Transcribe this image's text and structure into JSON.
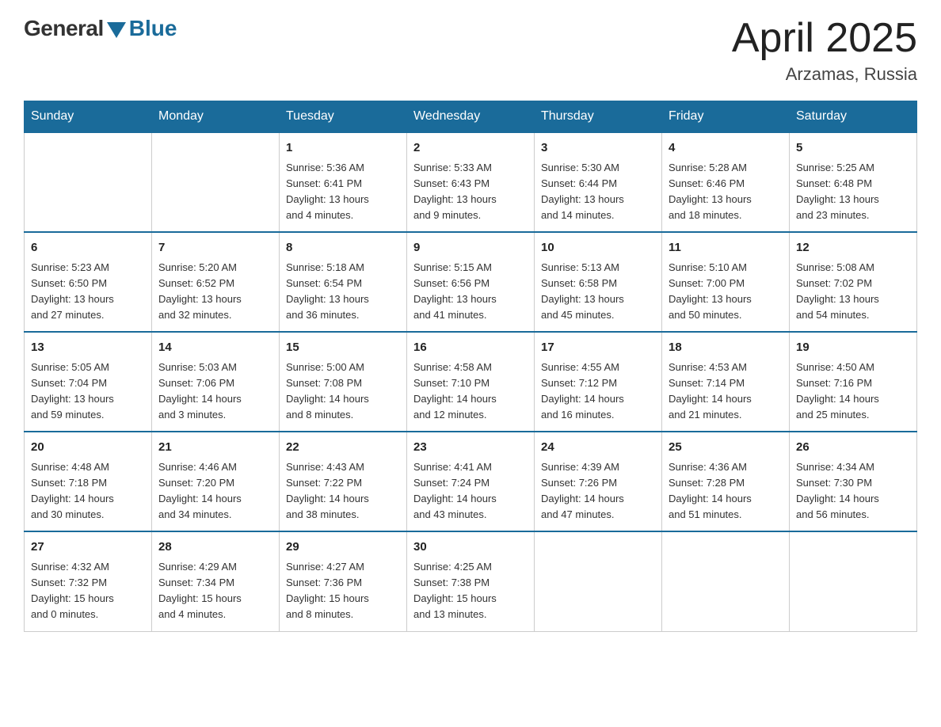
{
  "header": {
    "logo_general": "General",
    "logo_blue": "Blue",
    "title": "April 2025",
    "location": "Arzamas, Russia"
  },
  "days_of_week": [
    "Sunday",
    "Monday",
    "Tuesday",
    "Wednesday",
    "Thursday",
    "Friday",
    "Saturday"
  ],
  "weeks": [
    [
      {
        "day": "",
        "info": ""
      },
      {
        "day": "",
        "info": ""
      },
      {
        "day": "1",
        "info": "Sunrise: 5:36 AM\nSunset: 6:41 PM\nDaylight: 13 hours\nand 4 minutes."
      },
      {
        "day": "2",
        "info": "Sunrise: 5:33 AM\nSunset: 6:43 PM\nDaylight: 13 hours\nand 9 minutes."
      },
      {
        "day": "3",
        "info": "Sunrise: 5:30 AM\nSunset: 6:44 PM\nDaylight: 13 hours\nand 14 minutes."
      },
      {
        "day": "4",
        "info": "Sunrise: 5:28 AM\nSunset: 6:46 PM\nDaylight: 13 hours\nand 18 minutes."
      },
      {
        "day": "5",
        "info": "Sunrise: 5:25 AM\nSunset: 6:48 PM\nDaylight: 13 hours\nand 23 minutes."
      }
    ],
    [
      {
        "day": "6",
        "info": "Sunrise: 5:23 AM\nSunset: 6:50 PM\nDaylight: 13 hours\nand 27 minutes."
      },
      {
        "day": "7",
        "info": "Sunrise: 5:20 AM\nSunset: 6:52 PM\nDaylight: 13 hours\nand 32 minutes."
      },
      {
        "day": "8",
        "info": "Sunrise: 5:18 AM\nSunset: 6:54 PM\nDaylight: 13 hours\nand 36 minutes."
      },
      {
        "day": "9",
        "info": "Sunrise: 5:15 AM\nSunset: 6:56 PM\nDaylight: 13 hours\nand 41 minutes."
      },
      {
        "day": "10",
        "info": "Sunrise: 5:13 AM\nSunset: 6:58 PM\nDaylight: 13 hours\nand 45 minutes."
      },
      {
        "day": "11",
        "info": "Sunrise: 5:10 AM\nSunset: 7:00 PM\nDaylight: 13 hours\nand 50 minutes."
      },
      {
        "day": "12",
        "info": "Sunrise: 5:08 AM\nSunset: 7:02 PM\nDaylight: 13 hours\nand 54 minutes."
      }
    ],
    [
      {
        "day": "13",
        "info": "Sunrise: 5:05 AM\nSunset: 7:04 PM\nDaylight: 13 hours\nand 59 minutes."
      },
      {
        "day": "14",
        "info": "Sunrise: 5:03 AM\nSunset: 7:06 PM\nDaylight: 14 hours\nand 3 minutes."
      },
      {
        "day": "15",
        "info": "Sunrise: 5:00 AM\nSunset: 7:08 PM\nDaylight: 14 hours\nand 8 minutes."
      },
      {
        "day": "16",
        "info": "Sunrise: 4:58 AM\nSunset: 7:10 PM\nDaylight: 14 hours\nand 12 minutes."
      },
      {
        "day": "17",
        "info": "Sunrise: 4:55 AM\nSunset: 7:12 PM\nDaylight: 14 hours\nand 16 minutes."
      },
      {
        "day": "18",
        "info": "Sunrise: 4:53 AM\nSunset: 7:14 PM\nDaylight: 14 hours\nand 21 minutes."
      },
      {
        "day": "19",
        "info": "Sunrise: 4:50 AM\nSunset: 7:16 PM\nDaylight: 14 hours\nand 25 minutes."
      }
    ],
    [
      {
        "day": "20",
        "info": "Sunrise: 4:48 AM\nSunset: 7:18 PM\nDaylight: 14 hours\nand 30 minutes."
      },
      {
        "day": "21",
        "info": "Sunrise: 4:46 AM\nSunset: 7:20 PM\nDaylight: 14 hours\nand 34 minutes."
      },
      {
        "day": "22",
        "info": "Sunrise: 4:43 AM\nSunset: 7:22 PM\nDaylight: 14 hours\nand 38 minutes."
      },
      {
        "day": "23",
        "info": "Sunrise: 4:41 AM\nSunset: 7:24 PM\nDaylight: 14 hours\nand 43 minutes."
      },
      {
        "day": "24",
        "info": "Sunrise: 4:39 AM\nSunset: 7:26 PM\nDaylight: 14 hours\nand 47 minutes."
      },
      {
        "day": "25",
        "info": "Sunrise: 4:36 AM\nSunset: 7:28 PM\nDaylight: 14 hours\nand 51 minutes."
      },
      {
        "day": "26",
        "info": "Sunrise: 4:34 AM\nSunset: 7:30 PM\nDaylight: 14 hours\nand 56 minutes."
      }
    ],
    [
      {
        "day": "27",
        "info": "Sunrise: 4:32 AM\nSunset: 7:32 PM\nDaylight: 15 hours\nand 0 minutes."
      },
      {
        "day": "28",
        "info": "Sunrise: 4:29 AM\nSunset: 7:34 PM\nDaylight: 15 hours\nand 4 minutes."
      },
      {
        "day": "29",
        "info": "Sunrise: 4:27 AM\nSunset: 7:36 PM\nDaylight: 15 hours\nand 8 minutes."
      },
      {
        "day": "30",
        "info": "Sunrise: 4:25 AM\nSunset: 7:38 PM\nDaylight: 15 hours\nand 13 minutes."
      },
      {
        "day": "",
        "info": ""
      },
      {
        "day": "",
        "info": ""
      },
      {
        "day": "",
        "info": ""
      }
    ]
  ]
}
